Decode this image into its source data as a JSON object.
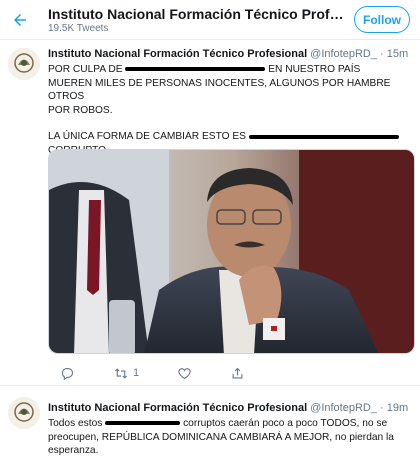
{
  "header": {
    "title": "Instituto Nacional Formación Técnico Profesi...",
    "subtitle": "19.5K Tweets",
    "follow_label": "Follow"
  },
  "tweets": [
    {
      "author": "Instituto Nacional Formación Técnico Profesional",
      "handle": "@InfotepRD_",
      "time": "· 15m",
      "line1a": "POR CULPA DE",
      "line1b": "EN NUESTRO PAÍS",
      "line2": "MUEREN MILES DE PERSONAS INOCENTES, ALGUNOS POR HAMBRE OTROS",
      "line3": "POR ROBOS.",
      "line4": "LA ÚNICA FORMA DE CAMBIAR ESTO ES",
      "line5": "CORRUPTO.",
      "retweets": "1"
    },
    {
      "author": "Instituto Nacional Formación Técnico Profesional",
      "handle": "@InfotepRD_",
      "time": "· 19m",
      "line1a": "Todos estos",
      "line1b": "corruptos caerán poco a poco TODOS, no se",
      "line2": "preocupen, REPÚBLICA DOMINICANA CAMBIARÁ A MEJOR, no pierdan la",
      "line3": "esperanza."
    }
  ],
  "colors": {
    "accent": "#1da1f2",
    "text": "#14171a",
    "muted": "#657786",
    "border": "#e6ecf0"
  },
  "icons": [
    "back-arrow-icon",
    "reply-icon",
    "retweet-icon",
    "like-icon",
    "share-icon"
  ]
}
